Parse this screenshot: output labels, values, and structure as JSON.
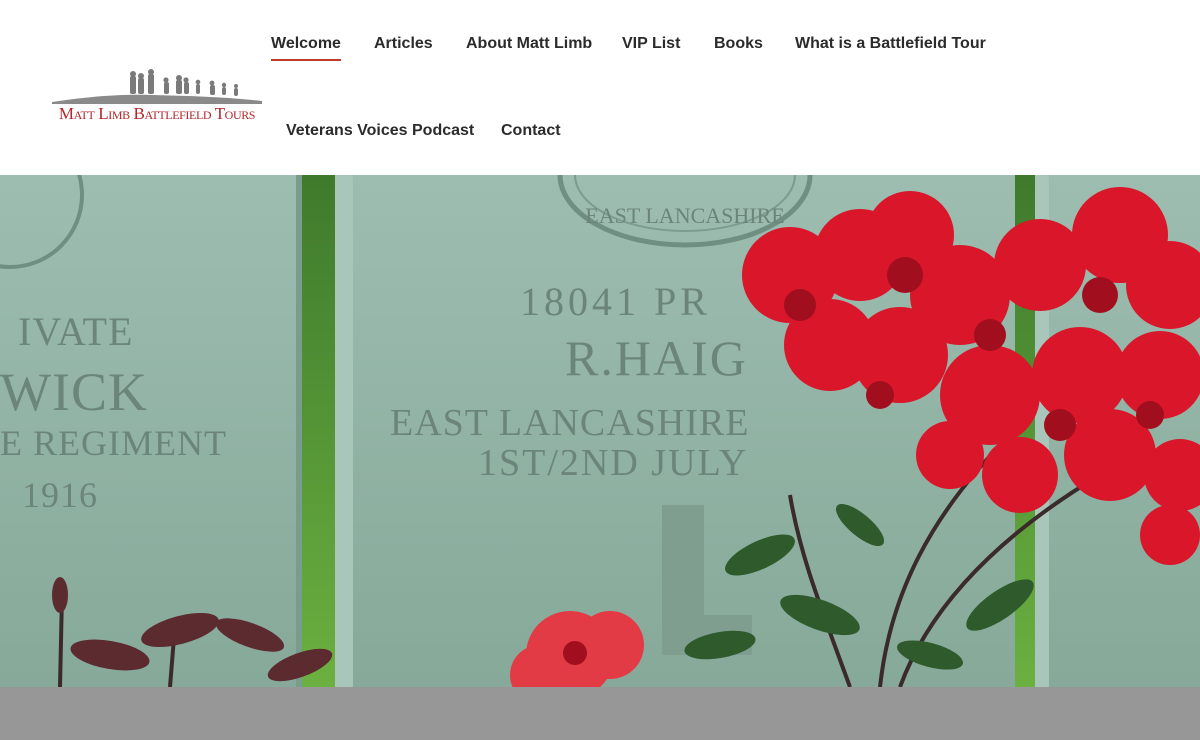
{
  "site": {
    "logo_text": "Matt Limb Battlefield Tours"
  },
  "nav": {
    "items": [
      {
        "label": "Welcome",
        "active": true
      },
      {
        "label": "Articles"
      },
      {
        "label": "About Matt Limb"
      },
      {
        "label": "VIP List"
      },
      {
        "label": "Books"
      },
      {
        "label": "What is a Battlefield Tour"
      },
      {
        "label": "Veterans Voices Podcast"
      },
      {
        "label": "Contact"
      }
    ],
    "accent_color": "#c0392b"
  },
  "hero": {
    "headstone_left": {
      "lines": [
        "IVATE",
        "WICK",
        "E REGIMENT",
        "1916"
      ]
    },
    "headstone_center": {
      "crest_text": "EAST LANCASHIRE",
      "lines": [
        "18041 PR",
        "R.HAIG",
        "EAST LANCASHIRE",
        "1ST/2ND JULY"
      ]
    }
  },
  "colors": {
    "stone": "#8fb3a3",
    "rose_red": "#d9162a",
    "grass": "#5a9a3a",
    "footer_band": "#979797"
  }
}
